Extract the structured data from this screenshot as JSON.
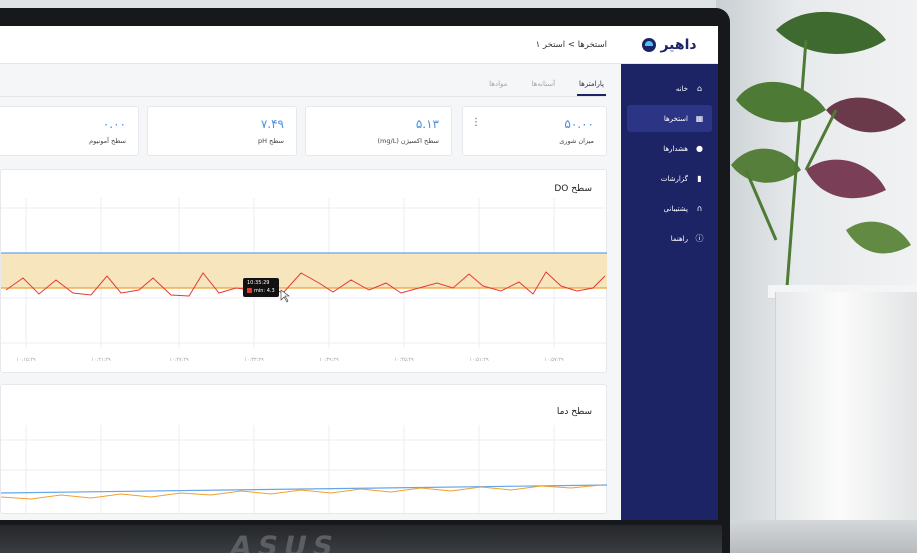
{
  "app": {
    "brand": "داهیر",
    "breadcrumb": "استخرها > استخر ۱"
  },
  "sidebar": {
    "items": [
      {
        "label": "خانه",
        "icon": "home-icon",
        "active": false
      },
      {
        "label": "استخرها",
        "icon": "grid-icon",
        "active": true
      },
      {
        "label": "هشدارها",
        "icon": "bell-icon",
        "active": false
      },
      {
        "label": "گزارشات",
        "icon": "bar-chart-icon",
        "active": false
      },
      {
        "label": "پشتیبانی",
        "icon": "headset-icon",
        "active": false
      },
      {
        "label": "راهنما",
        "icon": "info-icon",
        "active": false
      }
    ]
  },
  "tabs": [
    {
      "label": "پارامترها",
      "active": true
    },
    {
      "label": "آستانه‌ها",
      "active": false
    },
    {
      "label": "موادها",
      "active": false
    }
  ],
  "cards": [
    {
      "value": "۵۰.۰۰",
      "label": "میزان شوری"
    },
    {
      "value": "۵.۱۳",
      "label": "سطح اکسیژن (mg/L)"
    },
    {
      "value": "۷.۴۹",
      "label": "سطح pH"
    },
    {
      "value": "۰.۰۰",
      "label": "سطح آمونیوم"
    }
  ],
  "charts": {
    "do": {
      "title": "سطح DO",
      "x_ticks": [
        "۱۰:۱۵:۲۹",
        "۱۰:۲۱:۲۹",
        "۱۰:۲۷:۲۹",
        "۱۰:۳۳:۲۹",
        "۱۰:۳۹:۲۹",
        "۱۰:۴۵:۲۹",
        "۱۰:۵۱:۲۹",
        "۱۰:۵۷:۲۹"
      ],
      "tooltip": {
        "time": "10:35:29",
        "text": "min: 4.3"
      }
    },
    "temp": {
      "title": "سطح دما"
    }
  },
  "colors": {
    "sidebar": "#1c2466",
    "accent": "#4a90e2",
    "series_red": "#e53935",
    "threshold_blue": "#64a6e8",
    "threshold_orange": "#f0a030",
    "band": "#f7e6bd"
  },
  "environment": {
    "laptop_brand": "ASUS"
  }
}
